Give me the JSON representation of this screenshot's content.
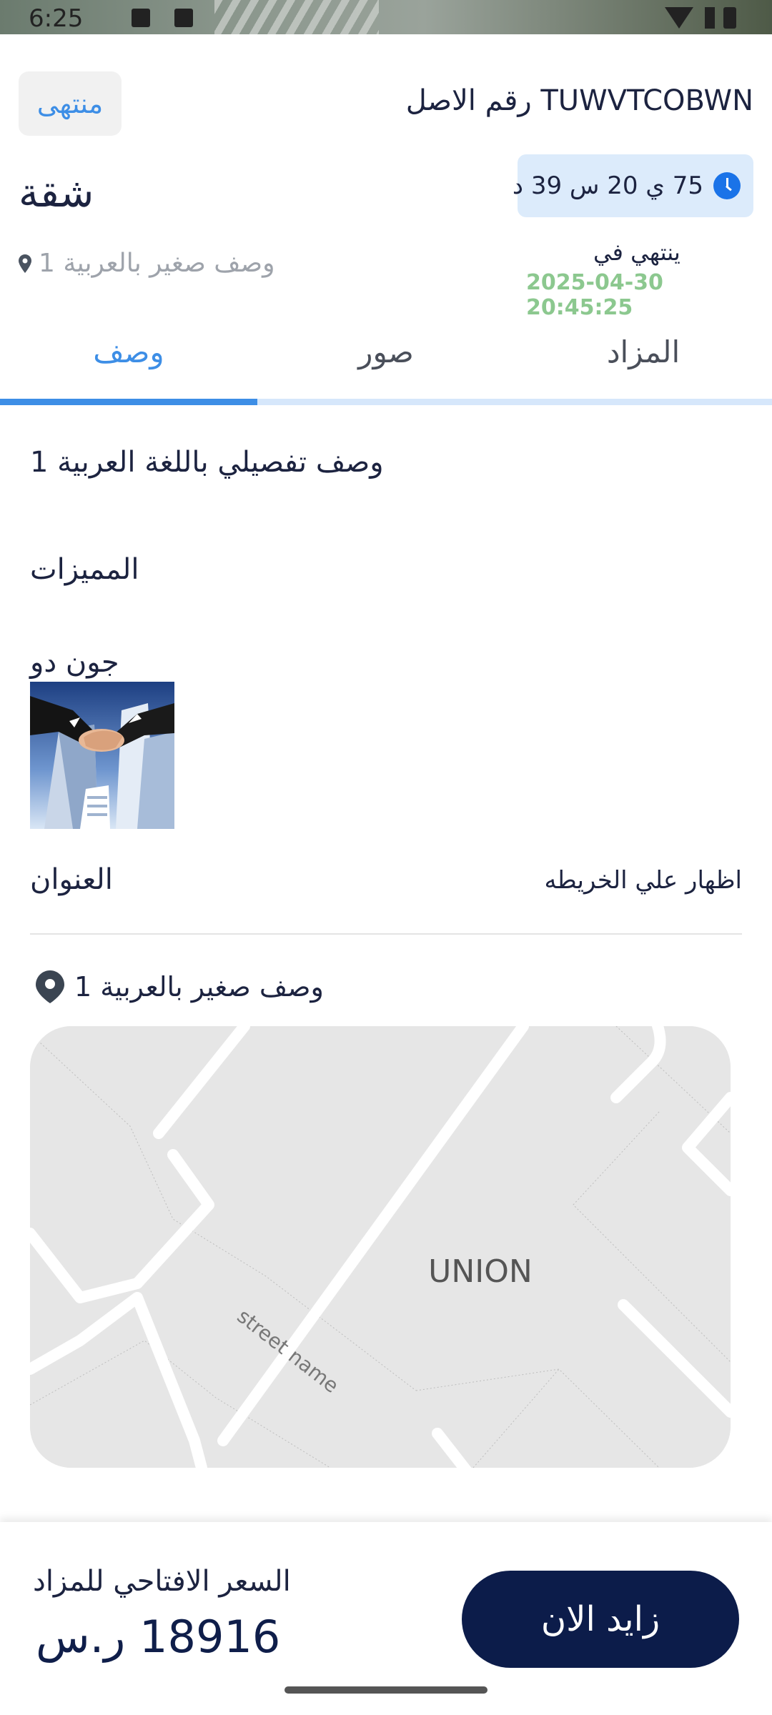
{
  "status_bar": {
    "time": "6:25"
  },
  "header": {
    "expired_badge": "منتهى",
    "asset_number": "TUWVTCOBWN رقم الاصل",
    "category": "شقة",
    "countdown": "75 ي 20 س 39 د",
    "short_description": "وصف صغير بالعربية 1",
    "ends_label": "ينتهي في",
    "ends_date": "2025-04-30 20:45:25"
  },
  "tabs": [
    {
      "label": "وصف",
      "active": true
    },
    {
      "label": "صور",
      "active": false
    },
    {
      "label": "المزاد",
      "active": false
    }
  ],
  "description": {
    "detail": "وصف تفصيلي باللغة العربية 1",
    "features_title": "المميزات",
    "owner_name": "جون دو"
  },
  "address": {
    "label": "العنوان",
    "show_on_map": "اظهار علي الخريطه",
    "line": "وصف صغير بالعربية 1"
  },
  "map": {
    "area_label": "UNION",
    "street_label": "street name"
  },
  "bottom_bar": {
    "price_label": "السعر الافتاحي للمزاد",
    "price_value": "18916 ر.س",
    "bid_button": "زايد الان"
  },
  "colors": {
    "accent": "#3d8ee6",
    "navy": "#0c1c4a",
    "date_green": "#8cc88f",
    "timer_bg": "#dcebfb"
  }
}
